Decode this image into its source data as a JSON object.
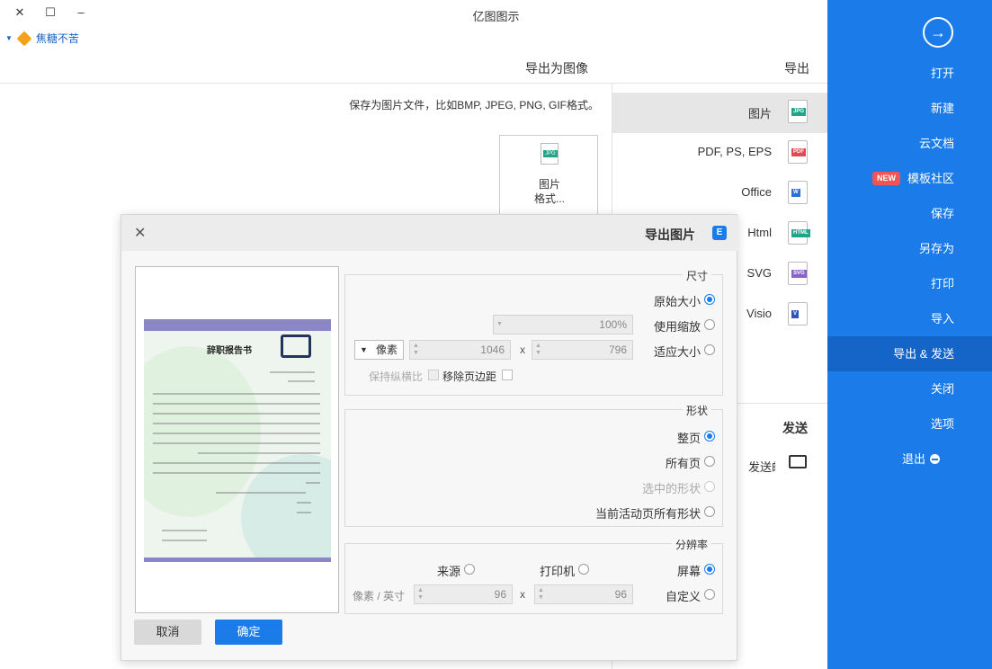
{
  "window": {
    "title": "亿图图示",
    "controls": {
      "close": "✕",
      "maximize": "☐",
      "minimize": "–"
    }
  },
  "user": {
    "name": "焦糖不苦"
  },
  "sidebar": {
    "items": [
      {
        "label": "打开"
      },
      {
        "label": "新建"
      },
      {
        "label": "云文档"
      },
      {
        "label": "模板社区",
        "badge": "NEW"
      },
      {
        "label": "保存"
      },
      {
        "label": "另存为"
      },
      {
        "label": "打印"
      },
      {
        "label": "导入"
      },
      {
        "label": "导出 & 发送",
        "active": true
      },
      {
        "label": "关闭"
      },
      {
        "label": "选项"
      },
      {
        "label": "退出"
      }
    ]
  },
  "export": {
    "section_title": "导出",
    "formats": [
      {
        "label": "图片",
        "tag": "JPG",
        "color": "#20a589",
        "active": true
      },
      {
        "label": "PDF, PS, EPS",
        "tag": "PDF",
        "color": "#e14b4b"
      },
      {
        "label": "Office",
        "tag": "W",
        "color": "#2e6fd2"
      },
      {
        "label": "Html",
        "tag": "HTML",
        "color": "#20a589"
      },
      {
        "label": "SVG",
        "tag": "SVG",
        "color": "#8a63c9"
      },
      {
        "label": "Visio",
        "tag": "V",
        "color": "#2e55b8"
      }
    ],
    "send_title": "发送",
    "send_item": "发送邮件"
  },
  "main": {
    "heading": "导出为图像",
    "description": "保存为图片文件，比如BMP, JPEG, PNG, GIF格式。",
    "card_text_1": "图片",
    "card_text_2": "格式..."
  },
  "dialog": {
    "title": "导出图片",
    "size": {
      "legend": "尺寸",
      "original": "原始大小",
      "use_scale": "使用缩放",
      "scale_value": "100%",
      "fit_size": "适应大小",
      "width": "1046",
      "height": "796",
      "unit": "像素",
      "remove_margin": "移除页边距",
      "keep_ratio": "保持纵横比"
    },
    "shape": {
      "legend": "形状",
      "whole_page": "整页",
      "all_pages": "所有页",
      "selected": "选中的形状",
      "active_page_shapes": "当前活动页所有形状"
    },
    "resolution": {
      "legend": "分辨率",
      "screen": "屏幕",
      "printer": "打印机",
      "source": "来源",
      "custom": "自定义",
      "dpi_x": "96",
      "dpi_y": "96",
      "unit": "像素 / 英寸"
    },
    "preview": {
      "doc_title": "辞职报告书"
    },
    "ok": "确定",
    "cancel": "取消"
  }
}
